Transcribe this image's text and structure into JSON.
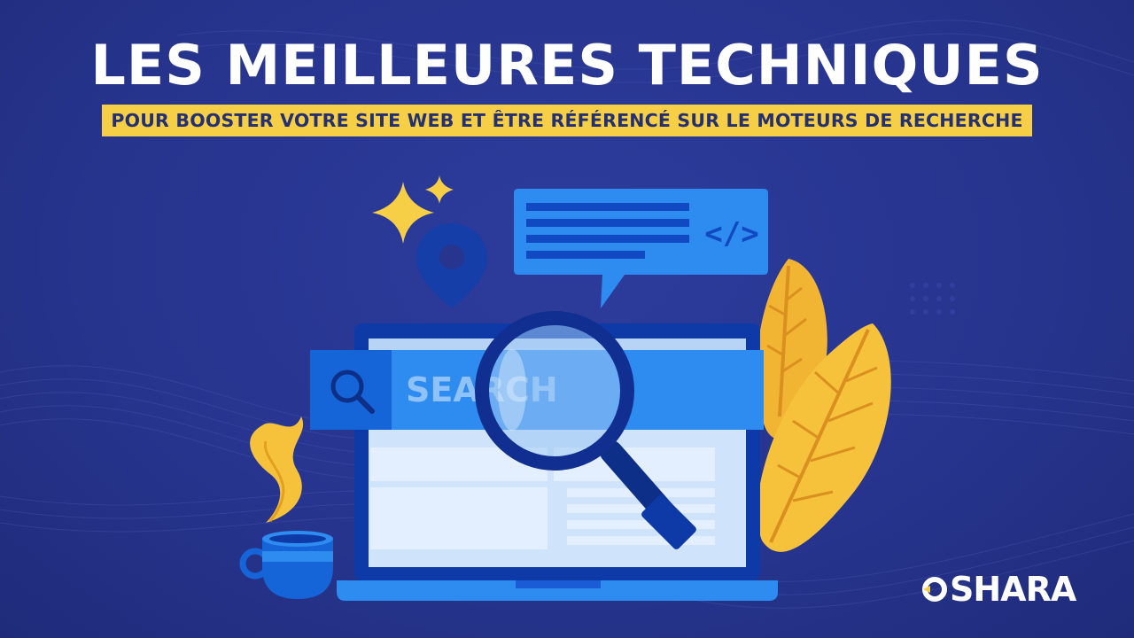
{
  "header": {
    "title": "LES MEILLEURES TECHNIQUES",
    "subtitle": "POUR BOOSTER VOTRE SITE WEB ET ÊTRE RÉFÉRENCÉ SUR LE MOTEURS DE RECHERCHE"
  },
  "illustration": {
    "search_bar_text": "SEARCH",
    "code_tag": "</>",
    "icons": [
      "sparkle-icon",
      "location-pin-icon",
      "code-bubble-icon",
      "search-icon",
      "magnifying-glass-icon",
      "laptop-icon",
      "coffee-cup-icon",
      "leaf-icon"
    ]
  },
  "brand": {
    "logo_text": "SHARA",
    "logo_lettering": "OSHARA"
  },
  "colors": {
    "background": "#27358f",
    "accent_yellow": "#f7cf46",
    "title_text": "#ffffff",
    "bubble_blue": "#2e8bf0",
    "laptop_dark": "#0e3aa8"
  }
}
